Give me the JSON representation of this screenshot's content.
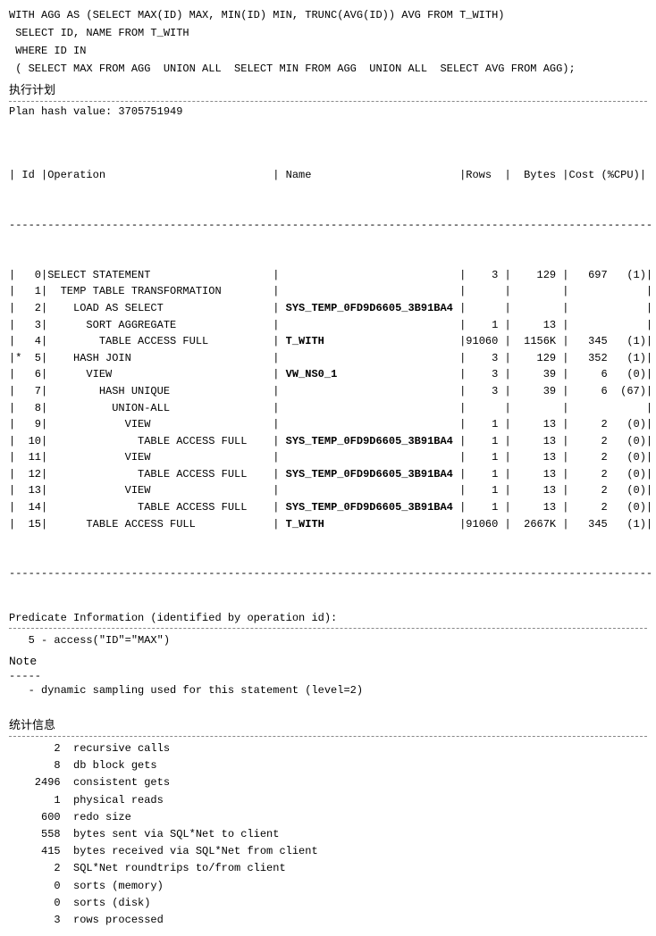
{
  "sql": {
    "line1": "WITH AGG AS (SELECT MAX(ID) MAX, MIN(ID) MIN, TRUNC(AVG(ID)) AVG FROM T_WITH)",
    "line2": " SELECT ID, NAME FROM T_WITH",
    "line3": " WHERE ID IN",
    "line4": " ( SELECT MAX FROM AGG  UNION ALL  SELECT MIN FROM AGG  UNION ALL  SELECT AVG FROM AGG);",
    "exec_title": "执行计划"
  },
  "divider_char": "--------------------------------------------------------------------------------",
  "plan": {
    "hash_label": "Plan hash value: 3705751949",
    "header": "| Id |Operation                          | Name                       |Rows  |  Bytes |Cost (%CPU)|",
    "sep": "----------------------------------------------------------------------------------------------------",
    "rows": [
      "|   0|SELECT STATEMENT                   |                            |    3 |    129 |   697   (1)|",
      "|   1|  TEMP TABLE TRANSFORMATION        |                            |      |        |            |",
      "|   2|    LOAD AS SELECT                 | SYS_TEMP_0FD9D6605_3B91BA4 |      |        |            |",
      "|   3|      SORT AGGREGATE               |                            |    1 |     13 |            |",
      "|   4|        TABLE ACCESS FULL          | T_WITH                     |91060 |  1156K |   345   (1)|",
      "|*  5|    HASH JOIN                      |                            |    3 |    129 |   352   (1)|",
      "|   6|      VIEW                         | VW_NS0_1                   |    3 |     39 |     6   (0)|",
      "|   7|        HASH UNIQUE                |                            |    3 |     39 |     6  (67)|",
      "|   8|          UNION-ALL                |                            |      |        |            |",
      "|   9|            VIEW                   |                            |    1 |     13 |     2   (0)|",
      "|  10|              TABLE ACCESS FULL    | SYS_TEMP_0FD9D6605_3B91BA4 |    1 |     13 |     2   (0)|",
      "|  11|            VIEW                   |                            |    1 |     13 |     2   (0)|",
      "|  12|              TABLE ACCESS FULL    | SYS_TEMP_0FD9D6605_3B91BA4 |    1 |     13 |     2   (0)|",
      "|  13|            VIEW                   |                            |    1 |     13 |     2   (0)|",
      "|  14|              TABLE ACCESS FULL    | SYS_TEMP_0FD9D6605_3B91BA4 |    1 |     13 |     2   (0)|",
      "|  15|      TABLE ACCESS FULL            | T_WITH                     |91060 |  2667K |   345   (1)|"
    ]
  },
  "predicate": {
    "title": "Predicate Information (identified by operation id):",
    "content": "   5 - access(\"ID\"=\"MAX\")"
  },
  "note": {
    "title": "Note",
    "dashes": "-----",
    "content": "   - dynamic sampling used for this statement (level=2)"
  },
  "stats": {
    "title": "统计信息",
    "divider": "--------------------------------------------------------------------------------",
    "items": [
      {
        "value": "2",
        "label": "recursive calls"
      },
      {
        "value": "8",
        "label": "db block gets"
      },
      {
        "value": "2496",
        "label": "consistent gets"
      },
      {
        "value": "1",
        "label": "physical reads"
      },
      {
        "value": "600",
        "label": "redo size"
      },
      {
        "value": "558",
        "label": "bytes sent via SQL*Net to client"
      },
      {
        "value": "415",
        "label": "bytes received via SQL*Net from client"
      },
      {
        "value": "2",
        "label": "SQL*Net roundtrips to/from client"
      },
      {
        "value": "0",
        "label": "sorts (memory)"
      },
      {
        "value": "0",
        "label": "sorts (disk)"
      },
      {
        "value": "3",
        "label": "rows processed"
      }
    ]
  }
}
